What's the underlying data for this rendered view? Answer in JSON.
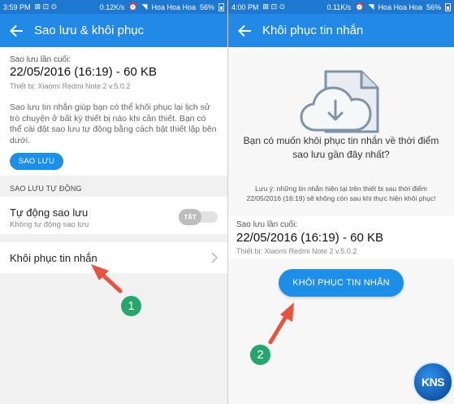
{
  "left": {
    "status": {
      "time": "3:59 PM",
      "speed": "0.12K/s",
      "carrier": "Hoa Hoa Hoa",
      "battery": "56%"
    },
    "appbar_title": "Sao lưu & khôi phục",
    "last_backup_label": "Sao lưu lần cuối:",
    "last_backup_date": "22/05/2016 (16:19) - 60 KB",
    "device": "Thiết bị: Xiaomi Redmi Note 2 v.5.0.2",
    "description": "Sao lưu tin nhắn giúp bạn có thể khôi phục lại lịch sử trò chuyện ở bất kỳ thiết bị nào khi cần thiết. Bạn có thể cài đặt sao lưu tự động bằng cách bật thiết lập bên dưới.",
    "backup_button": "SAO LƯU",
    "auto_section_header": "SAO LƯU TỰ ĐỘNG",
    "auto_title": "Tự động sao lưu",
    "auto_subtitle": "Không tự động sao lưu",
    "toggle_label": "TẮT",
    "restore_row_label": "Khôi phục tin nhắn"
  },
  "right": {
    "status": {
      "time": "4:00 PM",
      "speed": "0.11K/s",
      "carrier": "Hoa Hoa Hoa",
      "battery": "56%"
    },
    "appbar_title": "Khôi phục tin nhắn",
    "prompt": "Bạn có muốn khôi phục tin nhắn về thời điểm sao lưu gần đây nhất?",
    "note": "Lưu ý: những tin nhắn hiện tại trên thiết bị sau thời điểm 22/05/2016 (16:19) sẽ không còn sau khi thực hiện khôi phục!",
    "last_backup_label": "Sao lưu lần cuối:",
    "last_backup_date": "22/05/2016 (16:19) - 60 KB",
    "device": "Thiết bị: Xiaomi Redmi Note 2 v.5.0.2",
    "restore_button": "KHÔI PHỤC TIN NHẮN"
  },
  "annotations": {
    "step1": "1",
    "step2": "2",
    "watermark": "KNS"
  },
  "icons": [
    "back-arrow-icon",
    "chevron-right-icon",
    "cloud-download-icon",
    "wifi-icon",
    "battery-icon"
  ],
  "colors": {
    "appbar": "#2389e6",
    "statusbar": "#1e78d2",
    "button": "#1e8fe8",
    "arrow": "#e8533f",
    "badge": "#27a56c"
  }
}
